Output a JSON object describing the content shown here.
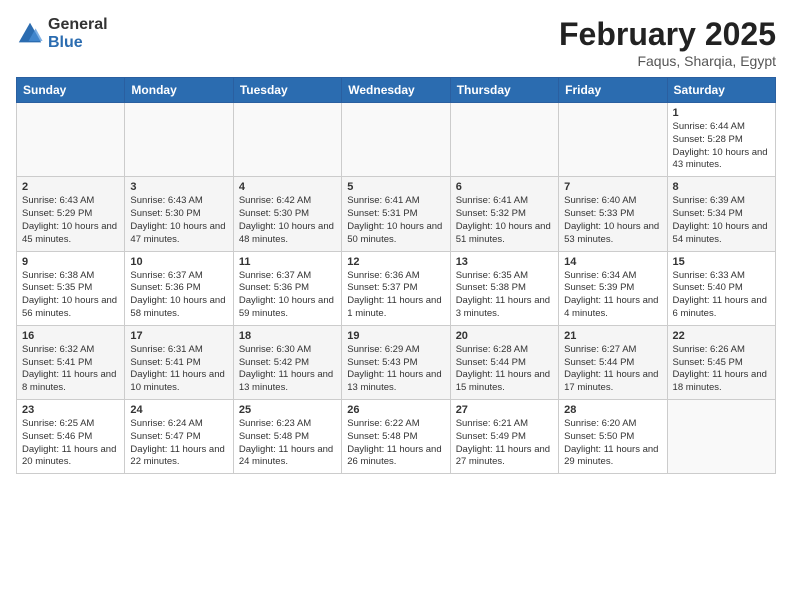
{
  "header": {
    "logo_general": "General",
    "logo_blue": "Blue",
    "month_title": "February 2025",
    "subtitle": "Faqus, Sharqia, Egypt"
  },
  "days_of_week": [
    "Sunday",
    "Monday",
    "Tuesday",
    "Wednesday",
    "Thursday",
    "Friday",
    "Saturday"
  ],
  "weeks": [
    [
      {
        "day": "",
        "info": ""
      },
      {
        "day": "",
        "info": ""
      },
      {
        "day": "",
        "info": ""
      },
      {
        "day": "",
        "info": ""
      },
      {
        "day": "",
        "info": ""
      },
      {
        "day": "",
        "info": ""
      },
      {
        "day": "1",
        "info": "Sunrise: 6:44 AM\nSunset: 5:28 PM\nDaylight: 10 hours and 43 minutes."
      }
    ],
    [
      {
        "day": "2",
        "info": "Sunrise: 6:43 AM\nSunset: 5:29 PM\nDaylight: 10 hours and 45 minutes."
      },
      {
        "day": "3",
        "info": "Sunrise: 6:43 AM\nSunset: 5:30 PM\nDaylight: 10 hours and 47 minutes."
      },
      {
        "day": "4",
        "info": "Sunrise: 6:42 AM\nSunset: 5:30 PM\nDaylight: 10 hours and 48 minutes."
      },
      {
        "day": "5",
        "info": "Sunrise: 6:41 AM\nSunset: 5:31 PM\nDaylight: 10 hours and 50 minutes."
      },
      {
        "day": "6",
        "info": "Sunrise: 6:41 AM\nSunset: 5:32 PM\nDaylight: 10 hours and 51 minutes."
      },
      {
        "day": "7",
        "info": "Sunrise: 6:40 AM\nSunset: 5:33 PM\nDaylight: 10 hours and 53 minutes."
      },
      {
        "day": "8",
        "info": "Sunrise: 6:39 AM\nSunset: 5:34 PM\nDaylight: 10 hours and 54 minutes."
      }
    ],
    [
      {
        "day": "9",
        "info": "Sunrise: 6:38 AM\nSunset: 5:35 PM\nDaylight: 10 hours and 56 minutes."
      },
      {
        "day": "10",
        "info": "Sunrise: 6:37 AM\nSunset: 5:36 PM\nDaylight: 10 hours and 58 minutes."
      },
      {
        "day": "11",
        "info": "Sunrise: 6:37 AM\nSunset: 5:36 PM\nDaylight: 10 hours and 59 minutes."
      },
      {
        "day": "12",
        "info": "Sunrise: 6:36 AM\nSunset: 5:37 PM\nDaylight: 11 hours and 1 minute."
      },
      {
        "day": "13",
        "info": "Sunrise: 6:35 AM\nSunset: 5:38 PM\nDaylight: 11 hours and 3 minutes."
      },
      {
        "day": "14",
        "info": "Sunrise: 6:34 AM\nSunset: 5:39 PM\nDaylight: 11 hours and 4 minutes."
      },
      {
        "day": "15",
        "info": "Sunrise: 6:33 AM\nSunset: 5:40 PM\nDaylight: 11 hours and 6 minutes."
      }
    ],
    [
      {
        "day": "16",
        "info": "Sunrise: 6:32 AM\nSunset: 5:41 PM\nDaylight: 11 hours and 8 minutes."
      },
      {
        "day": "17",
        "info": "Sunrise: 6:31 AM\nSunset: 5:41 PM\nDaylight: 11 hours and 10 minutes."
      },
      {
        "day": "18",
        "info": "Sunrise: 6:30 AM\nSunset: 5:42 PM\nDaylight: 11 hours and 13 minutes."
      },
      {
        "day": "19",
        "info": "Sunrise: 6:29 AM\nSunset: 5:43 PM\nDaylight: 11 hours and 13 minutes."
      },
      {
        "day": "20",
        "info": "Sunrise: 6:28 AM\nSunset: 5:44 PM\nDaylight: 11 hours and 15 minutes."
      },
      {
        "day": "21",
        "info": "Sunrise: 6:27 AM\nSunset: 5:44 PM\nDaylight: 11 hours and 17 minutes."
      },
      {
        "day": "22",
        "info": "Sunrise: 6:26 AM\nSunset: 5:45 PM\nDaylight: 11 hours and 18 minutes."
      }
    ],
    [
      {
        "day": "23",
        "info": "Sunrise: 6:25 AM\nSunset: 5:46 PM\nDaylight: 11 hours and 20 minutes."
      },
      {
        "day": "24",
        "info": "Sunrise: 6:24 AM\nSunset: 5:47 PM\nDaylight: 11 hours and 22 minutes."
      },
      {
        "day": "25",
        "info": "Sunrise: 6:23 AM\nSunset: 5:48 PM\nDaylight: 11 hours and 24 minutes."
      },
      {
        "day": "26",
        "info": "Sunrise: 6:22 AM\nSunset: 5:48 PM\nDaylight: 11 hours and 26 minutes."
      },
      {
        "day": "27",
        "info": "Sunrise: 6:21 AM\nSunset: 5:49 PM\nDaylight: 11 hours and 27 minutes."
      },
      {
        "day": "28",
        "info": "Sunrise: 6:20 AM\nSunset: 5:50 PM\nDaylight: 11 hours and 29 minutes."
      },
      {
        "day": "",
        "info": ""
      }
    ]
  ]
}
